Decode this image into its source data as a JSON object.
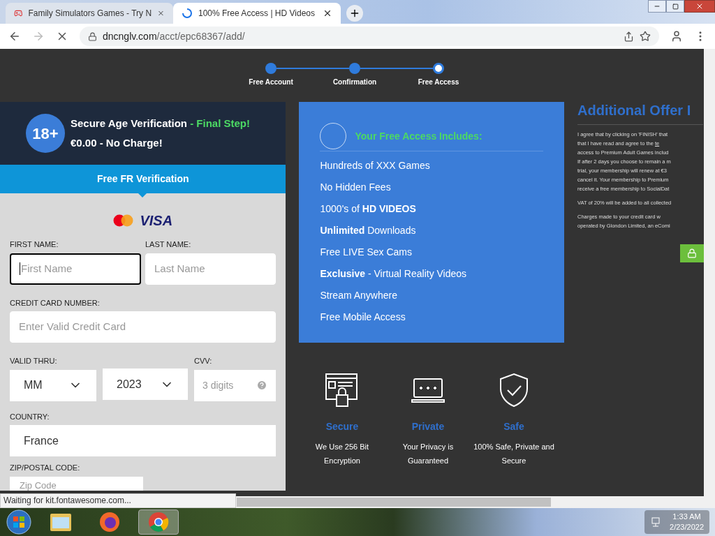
{
  "browser": {
    "tabs": [
      {
        "title": "Family Simulators Games - Try N",
        "selected": false,
        "kind": "gamepad"
      },
      {
        "title": "100% Free Access | HD Videos",
        "selected": true,
        "kind": "loading"
      }
    ],
    "url_host": "dncnglv.com",
    "url_path": "/acct/epc68367/add/",
    "status_text": "Waiting for kit.fontawesome.com..."
  },
  "steps": [
    {
      "label": "Free Account",
      "current": false
    },
    {
      "label": "Confirmation",
      "current": false
    },
    {
      "label": "Free Access",
      "current": true
    }
  ],
  "header": {
    "badge": "18+",
    "title": "Secure Age Verification",
    "highlight": "- Final Step!",
    "subtitle": "€0.00 - No Charge!"
  },
  "band": "Free FR Verification",
  "card_brand": "VISA",
  "form": {
    "first_name": {
      "label": "FIRST NAME:",
      "placeholder": "First Name",
      "focused": true
    },
    "last_name": {
      "label": "LAST NAME:",
      "placeholder": "Last Name",
      "focused": false
    },
    "card": {
      "label": "CREDIT CARD NUMBER:",
      "placeholder": "Enter Valid Credit Card"
    },
    "valid_label": "VALID THRU:",
    "month": "MM",
    "year": "2023",
    "cvv": {
      "label": "CVV:",
      "placeholder": "3 digits"
    },
    "country": {
      "label": "COUNTRY:",
      "value": "France"
    },
    "zip": {
      "label": "ZIP/POSTAL CODE:",
      "placeholder": "Zip Code"
    }
  },
  "includes": {
    "title": "Your Free Access Includes:",
    "items": [
      "Hundreds of XXX Games",
      "No Hidden Fees",
      "1000's of **HD VIDEOS**",
      "**Unlimited** Downloads",
      "Free LIVE Sex Cams",
      "**Exclusive** - Virtual Reality Videos",
      "Stream Anywhere",
      "Free Mobile Access"
    ]
  },
  "features": [
    {
      "kind": "lock",
      "title": "Secure",
      "lines": [
        "We Use 256 Bit",
        "Encryption"
      ]
    },
    {
      "kind": "laptop",
      "title": "Private",
      "lines": [
        "Your Privacy is",
        "Guaranteed"
      ]
    },
    {
      "kind": "shield",
      "title": "Safe",
      "lines": [
        "100% Safe, Private and",
        "Secure"
      ]
    }
  ],
  "offer": {
    "title": "Additional Offer I",
    "paragraphs": [
      [
        {
          "text": "I agree that by clicking on 'FINISH' that"
        },
        {
          "text": "that I have read and agree to the",
          "link": "te"
        },
        {
          "text": "access to Premium Adult Games includ"
        },
        {
          "text": "If after 2 days you choose to remain a m"
        },
        {
          "text": "trial, your membership will renew at €3"
        },
        {
          "text": "cancel it. Your membership to Premium"
        },
        {
          "text": "receive a free membership to SocialDat"
        }
      ],
      [
        {
          "text": "VAT of 20% will be added to all collected"
        }
      ],
      [
        {
          "text": "Charges made to your credit card w"
        },
        {
          "text": "operated by Glondon Limited, an eComi"
        }
      ]
    ]
  },
  "taskbar": {
    "apps": [
      {
        "kind": "folder",
        "selected": false
      },
      {
        "kind": "firefox",
        "selected": false
      },
      {
        "kind": "chrome",
        "selected": true
      }
    ],
    "time": "1:33 AM",
    "date": "2/23/2022"
  }
}
